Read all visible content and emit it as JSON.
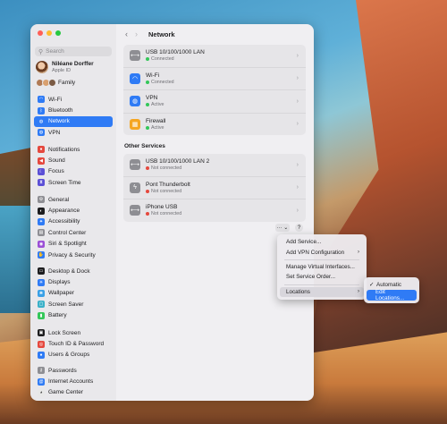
{
  "window": {
    "nav_title": "Network",
    "back_glyph": "‹",
    "forward_glyph": "›"
  },
  "sidebar": {
    "search_placeholder": "Search",
    "profile": {
      "name": "Niléane Dorffer",
      "sub": "Apple ID"
    },
    "family_label": "Family",
    "groups": [
      [
        {
          "label": "Wi-Fi",
          "icon": "wifi-icon",
          "color": "#2f7bf5"
        },
        {
          "label": "Bluetooth",
          "icon": "bluetooth-icon",
          "color": "#2f7bf5"
        },
        {
          "label": "Network",
          "icon": "globe-icon",
          "color": "#2f7bf5",
          "selected": true
        },
        {
          "label": "VPN",
          "icon": "vpn-icon",
          "color": "#2f7bf5"
        }
      ],
      [
        {
          "label": "Notifications",
          "icon": "bell-icon",
          "color": "#e5483e"
        },
        {
          "label": "Sound",
          "icon": "speaker-icon",
          "color": "#e5483e"
        },
        {
          "label": "Focus",
          "icon": "moon-icon",
          "color": "#5b4fd6"
        },
        {
          "label": "Screen Time",
          "icon": "hourglass-icon",
          "color": "#5b4fd6"
        }
      ],
      [
        {
          "label": "General",
          "icon": "gear-icon",
          "color": "#8e8e93"
        },
        {
          "label": "Appearance",
          "icon": "appearance-icon",
          "color": "#1d1d1f"
        },
        {
          "label": "Accessibility",
          "icon": "accessibility-icon",
          "color": "#2f7bf5"
        },
        {
          "label": "Control Center",
          "icon": "control-center-icon",
          "color": "#8e8e93"
        },
        {
          "label": "Siri & Spotlight",
          "icon": "siri-icon",
          "color": "#9b4fd6"
        },
        {
          "label": "Privacy & Security",
          "icon": "hand-icon",
          "color": "#2f7bf5"
        }
      ],
      [
        {
          "label": "Desktop & Dock",
          "icon": "dock-icon",
          "color": "#1d1d1f"
        },
        {
          "label": "Displays",
          "icon": "display-icon",
          "color": "#2f7bf5"
        },
        {
          "label": "Wallpaper",
          "icon": "wallpaper-icon",
          "color": "#3aa0e6"
        },
        {
          "label": "Screen Saver",
          "icon": "screensaver-icon",
          "color": "#3ab0c8"
        },
        {
          "label": "Battery",
          "icon": "battery-icon",
          "color": "#34c759"
        }
      ],
      [
        {
          "label": "Lock Screen",
          "icon": "lock-icon",
          "color": "#1d1d1f"
        },
        {
          "label": "Touch ID & Password",
          "icon": "fingerprint-icon",
          "color": "#e5483e"
        },
        {
          "label": "Users & Groups",
          "icon": "users-icon",
          "color": "#2f7bf5"
        }
      ],
      [
        {
          "label": "Passwords",
          "icon": "key-icon",
          "color": "#8e8e93"
        },
        {
          "label": "Internet Accounts",
          "icon": "at-icon",
          "color": "#2f7bf5"
        },
        {
          "label": "Game Center",
          "icon": "game-center-icon",
          "color": "#e8e8e8"
        }
      ]
    ]
  },
  "services": [
    {
      "title": "USB 10/100/1000 LAN",
      "status": "Connected",
      "status_color": "#34c759",
      "icon": "ethernet-icon",
      "icon_color": "#8e8e93"
    },
    {
      "title": "Wi-Fi",
      "status": "Connected",
      "status_color": "#34c759",
      "icon": "wifi-icon",
      "icon_color": "#2f7bf5"
    },
    {
      "title": "VPN",
      "status": "Active",
      "status_color": "#34c759",
      "icon": "globe-icon",
      "icon_color": "#2f7bf5"
    },
    {
      "title": "Firewall",
      "status": "Active",
      "status_color": "#34c759",
      "icon": "firewall-icon",
      "icon_color": "#f5a623"
    }
  ],
  "other_services_title": "Other Services",
  "other_services": [
    {
      "title": "USB 10/100/1000 LAN 2",
      "status": "Not connected",
      "status_color": "#e5483e",
      "icon": "ethernet-icon",
      "icon_color": "#8e8e93"
    },
    {
      "title": "Pont Thunderbolt",
      "status": "Not connected",
      "status_color": "#e5483e",
      "icon": "thunderbolt-icon",
      "icon_color": "#8e8e93"
    },
    {
      "title": "iPhone USB",
      "status": "Not connected",
      "status_color": "#e5483e",
      "icon": "iphone-usb-icon",
      "icon_color": "#8e8e93"
    }
  ],
  "buttons": {
    "more": "··· ⌄",
    "help": "?"
  },
  "context_menu": {
    "items": [
      "Add Service...",
      "Add VPN Configuration",
      "Manage Virtual Interfaces...",
      "Set Service Order...",
      "Locations"
    ]
  },
  "locations_submenu": {
    "items": [
      "Automatic",
      "Edit Locations..."
    ],
    "checked": "✓"
  }
}
